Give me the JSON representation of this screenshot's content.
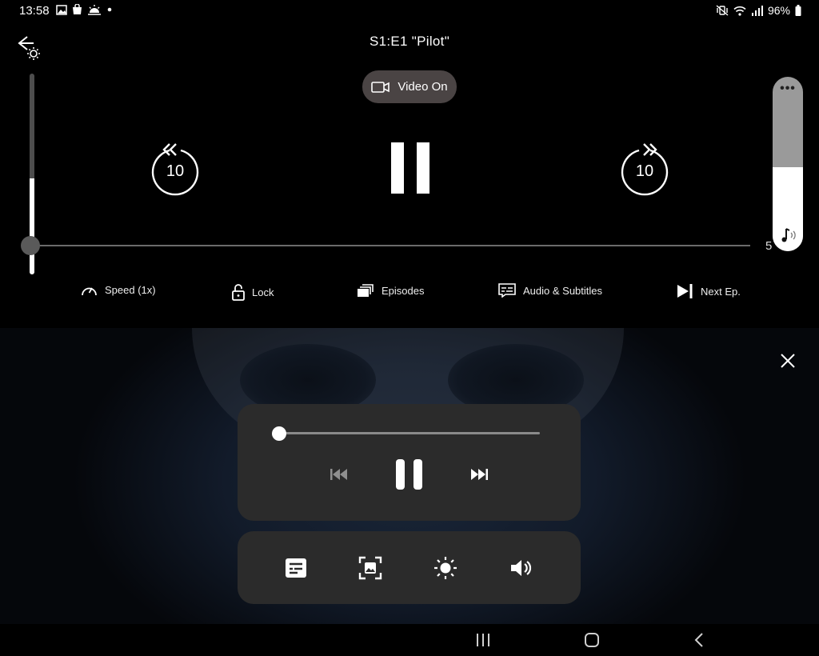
{
  "status_bar": {
    "time": "13:58",
    "battery": "96%",
    "left_icons": [
      "image-icon",
      "shopping-bag-icon",
      "weather-icon",
      "dot-icon"
    ],
    "right_icons": [
      "mute-vibrate-icon",
      "wifi-icon",
      "signal-icon",
      "battery-icon"
    ]
  },
  "player": {
    "title": "S1:E1 \"Pilot\"",
    "video_toggle": {
      "label": "Video On",
      "icon": "video-camera-icon"
    },
    "skip_back": {
      "seconds": "10",
      "icon": "rewind-10-icon"
    },
    "skip_forward": {
      "seconds": "10",
      "icon": "forward-10-icon"
    },
    "pause_icon": "pause-icon",
    "time_remaining": "5",
    "brightness_level": 0.48,
    "volume_level": 0.48,
    "progress": 0.0,
    "controls": {
      "speed": {
        "label": "Speed (1x)",
        "icon": "speedometer-icon"
      },
      "lock": {
        "label": "Lock",
        "icon": "unlock-icon"
      },
      "episodes": {
        "label": "Episodes",
        "icon": "episodes-icon"
      },
      "audio_subtitles": {
        "label": "Audio & Subtitles",
        "icon": "subtitles-icon"
      },
      "next_episode": {
        "label": "Next Ep.",
        "icon": "next-episode-icon"
      }
    }
  },
  "mini_player": {
    "progress": 0.0,
    "buttons": [
      "previous-track-icon",
      "pause-icon",
      "next-track-icon"
    ],
    "tools": [
      "subtitles-icon",
      "screenshot-icon",
      "brightness-icon",
      "volume-icon"
    ],
    "close_icon": "close-icon"
  },
  "nav_bar": {
    "buttons": [
      "recent-apps-icon",
      "home-icon",
      "back-icon"
    ]
  },
  "colors": {
    "background": "#000000",
    "pill": "#4a4444",
    "panel": "#2b2b2b",
    "accent": "#ffffff"
  }
}
